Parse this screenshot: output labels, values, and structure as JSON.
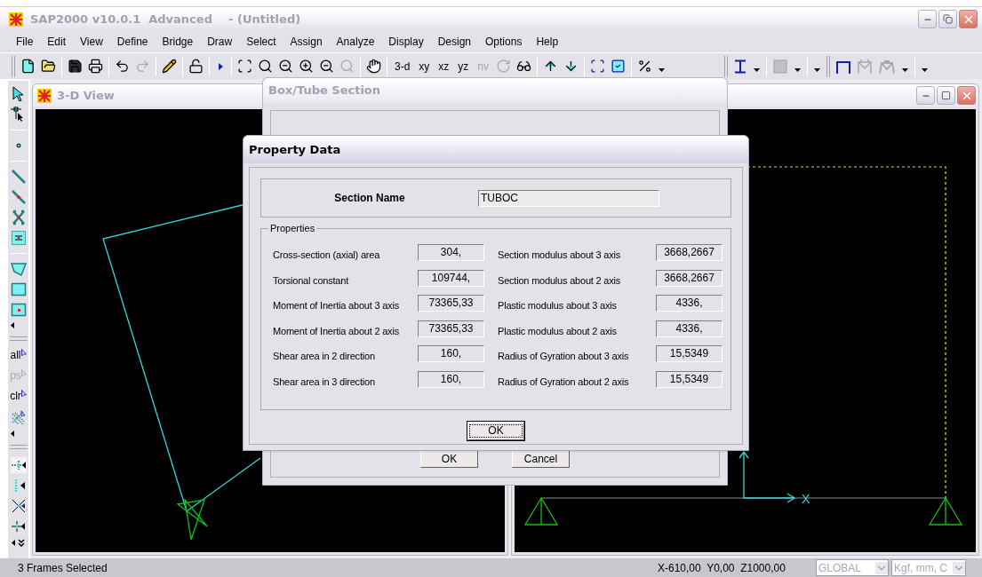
{
  "window": {
    "title": "SAP2000 v10.0.1  Advanced    - (Untitled)"
  },
  "menu": [
    "File",
    "Edit",
    "View",
    "Define",
    "Bridge",
    "Draw",
    "Select",
    "Assign",
    "Analyze",
    "Display",
    "Design",
    "Options",
    "Help"
  ],
  "toolbar": {
    "view_buttons": [
      {
        "label": "3-d",
        "disabled": false
      },
      {
        "label": "xy",
        "disabled": false
      },
      {
        "label": "xz",
        "disabled": false
      },
      {
        "label": "yz",
        "disabled": false
      },
      {
        "label": "nv",
        "disabled": true
      }
    ]
  },
  "side_toolbar": {
    "select_buttons": [
      {
        "label": "all",
        "disabled": false
      },
      {
        "label": "ps",
        "disabled": true
      },
      {
        "label": "clr",
        "disabled": false
      }
    ]
  },
  "view_window": {
    "title": "3-D View"
  },
  "plan_view": {
    "axis_label": "X"
  },
  "box_tube_dialog": {
    "title": "Box/Tube Section",
    "buttons": [
      "OK",
      "Cancel"
    ]
  },
  "property_dialog": {
    "title": "Property Data",
    "section_name_label": "Section Name",
    "section_name": "TUBOC",
    "group_title": "Properties",
    "left": [
      {
        "label": "Cross-section (axial) area",
        "value": "304,"
      },
      {
        "label": "Torsional constant",
        "value": "109744,"
      },
      {
        "label": "Moment of Inertia about 3 axis",
        "value": "73365,33"
      },
      {
        "label": "Moment of Inertia about 2 axis",
        "value": "73365,33"
      },
      {
        "label": "Shear area in 2 direction",
        "value": "160,"
      },
      {
        "label": "Shear area in 3 direction",
        "value": "160,"
      }
    ],
    "right": [
      {
        "label": "Section modulus about 3 axis",
        "value": "3668,2667"
      },
      {
        "label": "Section modulus about 2 axis",
        "value": "3668,2667"
      },
      {
        "label": "Plastic modulus about 3 axis",
        "value": "4336,"
      },
      {
        "label": "Plastic modulus about 2 axis",
        "value": "4336,"
      },
      {
        "label": "Radius of Gyration about 3 axis",
        "value": "15,5349"
      },
      {
        "label": "Radius of Gyration about 2 axis",
        "value": "15,5349"
      }
    ],
    "ok_button": {
      "label": "OK",
      "focused": true
    }
  },
  "status_bar": {
    "message": "3 Frames Selected",
    "coordinates": "X-610,00  Y0,00  Z1000,00",
    "coordinate_system": {
      "value": "GLOBAL",
      "disabled": true
    },
    "units": {
      "value": "Kgf, mm, C",
      "disabled": true
    }
  }
}
